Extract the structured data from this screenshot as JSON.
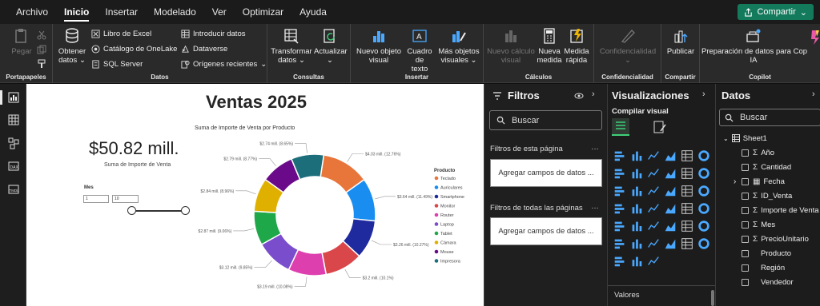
{
  "menu": {
    "items": [
      "Archivo",
      "Inicio",
      "Insertar",
      "Modelado",
      "Ver",
      "Optimizar",
      "Ayuda"
    ],
    "share_label": "Compartir"
  },
  "ribbon": {
    "portapapeles": {
      "paste": "Pegar",
      "label": "Portapapeles"
    },
    "datos": {
      "obtener": "Obtener",
      "obtener2": "datos",
      "excel": "Libro de Excel",
      "onelake": "Catálogo de OneLake",
      "sql": "SQL Server",
      "introducir": "Introducir datos",
      "dataverse": "Dataverse",
      "origenes": "Orígenes recientes",
      "label": "Datos"
    },
    "consultas": {
      "transformar": "Transformar",
      "transformar2": "datos",
      "actualizar": "Actualizar",
      "label": "Consultas"
    },
    "insertar": {
      "nuevo_visual": "Nuevo objeto",
      "nuevo_visual2": "visual",
      "cuadro_texto": "Cuadro de",
      "cuadro_texto2": "texto",
      "mas_visuales": "Más objetos",
      "mas_visuales2": "visuales",
      "label": "Insertar"
    },
    "calculos": {
      "nuevo_calculo": "Nuevo cálculo",
      "nuevo_calculo2": "visual",
      "nueva_medida": "Nueva",
      "nueva_medida2": "medida",
      "medida_rapida": "Medida",
      "medida_rapida2": "rápida",
      "label": "Cálculos"
    },
    "confidencialidad": {
      "btn": "Confidencialidad",
      "label": "Confidencialidad"
    },
    "compartir": {
      "btn": "Publicar",
      "label": "Compartir"
    },
    "copilot": {
      "btn": "Preparación de datos para Cop",
      "btn2": "IA",
      "label": "Copilot"
    }
  },
  "report": {
    "title": "Ventas 2025",
    "card_value": "$50.82 mill.",
    "card_label": "Suma de Importe de Venta",
    "slicer": {
      "title": "Mes",
      "from": "1",
      "to": "10"
    },
    "chart_title": "Suma de Importe de Venta por Producto"
  },
  "chart_data": {
    "type": "pie",
    "title": "Suma de Importe de Venta por Producto",
    "legend_title": "Producto",
    "legend_position": "right",
    "categories": [
      "Teclado",
      "Auriculares",
      "Smartphone",
      "Monitor",
      "Router",
      "Laptop",
      "Tablet",
      "Cámara",
      "Mouse",
      "Impresora"
    ],
    "values": [
      4.03,
      3.64,
      3.26,
      3.2,
      3.19,
      3.12,
      2.87,
      2.84,
      2.79,
      2.74
    ],
    "data_labels": [
      "$4.03 mill. (12.76%)",
      "$3.64 mill. (11.49%)",
      "$3.26 mill. (10.27%)",
      "$3.2 mill. (10.1%)",
      "$3.19 mill. (10.08%)",
      "$3.12 mill. (9.85%)",
      "$2.87 mill. (9.06%)",
      "$2.84 mill. (8.96%)",
      "$2.79 mill. (8.77%)",
      "$2.74 mill. (8.65%)"
    ],
    "colors": [
      "#e8753a",
      "#1a8ef0",
      "#1f2a9e",
      "#d9474b",
      "#de3fae",
      "#7a4dcc",
      "#1fa84a",
      "#e0b000",
      "#6a0a8a",
      "#1b6e7a"
    ]
  },
  "filters": {
    "title": "Filtros",
    "search_placeholder": "Buscar",
    "page_section": "Filtros de esta página",
    "all_section": "Filtros de todas las páginas",
    "drop_label": "Agregar campos de datos ..."
  },
  "visualizations": {
    "title": "Visualizaciones",
    "build_label": "Compilar visual",
    "values_label": "Valores"
  },
  "data": {
    "title": "Datos",
    "search_placeholder": "Buscar",
    "table": "Sheet1",
    "fields": [
      {
        "name": "Año",
        "sigma": true
      },
      {
        "name": "Cantidad",
        "sigma": true
      },
      {
        "name": "Fecha",
        "sigma": false,
        "table_icon": true
      },
      {
        "name": "ID_Venta",
        "sigma": true
      },
      {
        "name": "Importe de Venta",
        "sigma": true
      },
      {
        "name": "Mes",
        "sigma": true
      },
      {
        "name": "PrecioUnitario",
        "sigma": true
      },
      {
        "name": "Producto",
        "sigma": false
      },
      {
        "name": "Región",
        "sigma": false
      },
      {
        "name": "Vendedor",
        "sigma": false
      }
    ]
  }
}
